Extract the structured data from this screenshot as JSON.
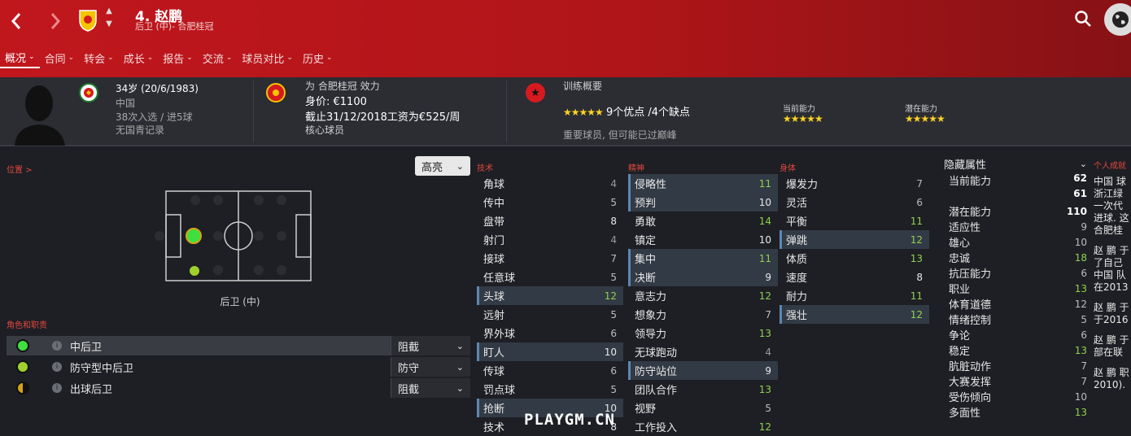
{
  "header": {
    "player_title": "4. 赵鹏",
    "player_subtitle": "后卫 (中)- 合肥桂冠",
    "tabs": [
      {
        "label": "概况"
      },
      {
        "label": "合同"
      },
      {
        "label": "转会"
      },
      {
        "label": "成长"
      },
      {
        "label": "报告"
      },
      {
        "label": "交流"
      },
      {
        "label": "球员对比"
      },
      {
        "label": "历史"
      }
    ],
    "accent_color": "#c0171d"
  },
  "info": {
    "age_line": "34岁 (20/6/1983)",
    "nation": "中国",
    "caps": "38次入选 / 进5球",
    "youth": "无国青记录",
    "club_line": "为 合肥桂冠 效力",
    "value_line": "身价: €1100",
    "contract_line": "截止31/12/2018工资为€525/周",
    "squad_status": "核心球员",
    "training_title": "训练概要",
    "strengths_weaknesses": "9个优点 /4个缺点",
    "training_note": "重要球员, 但可能已过巅峰",
    "current_ability_label": "当前能力",
    "potential_ability_label": "潜在能力",
    "rating_stars": 5
  },
  "position": {
    "title": "位置 >",
    "highlight_label": "高亮",
    "position_label": "后卫 (中)"
  },
  "roles": {
    "title": "角色和职责",
    "items": [
      {
        "name": "中后卫",
        "duty": "阻截",
        "color": "#3ee03e",
        "selected": true
      },
      {
        "name": "防守型中后卫",
        "duty": "防守",
        "color": "#9fd12e",
        "selected": false
      },
      {
        "name": "出球后卫",
        "duty": "阻截",
        "color": "#d4a21a",
        "selected": false
      }
    ]
  },
  "technical": {
    "title": "技术",
    "rows": [
      {
        "name": "角球",
        "value": "4",
        "hl": false
      },
      {
        "name": "传中",
        "value": "5",
        "hl": false
      },
      {
        "name": "盘带",
        "value": "8",
        "hl": false
      },
      {
        "name": "射门",
        "value": "4",
        "hl": false
      },
      {
        "name": "接球",
        "value": "7",
        "hl": false
      },
      {
        "name": "任意球",
        "value": "5",
        "hl": false
      },
      {
        "name": "头球",
        "value": "12",
        "hl": true
      },
      {
        "name": "远射",
        "value": "5",
        "hl": false
      },
      {
        "name": "界外球",
        "value": "6",
        "hl": false
      },
      {
        "name": "盯人",
        "value": "10",
        "hl": true
      },
      {
        "name": "传球",
        "value": "6",
        "hl": false
      },
      {
        "name": "罚点球",
        "value": "5",
        "hl": false
      },
      {
        "name": "抢断",
        "value": "10",
        "hl": true
      },
      {
        "name": "技术",
        "value": "8",
        "hl": false
      }
    ]
  },
  "mental": {
    "title": "精神",
    "rows": [
      {
        "name": "侵略性",
        "value": "11",
        "hl": true
      },
      {
        "name": "预判",
        "value": "10",
        "hl": true
      },
      {
        "name": "勇敢",
        "value": "14",
        "hl": false
      },
      {
        "name": "镇定",
        "value": "10",
        "hl": false
      },
      {
        "name": "集中",
        "value": "11",
        "hl": true
      },
      {
        "name": "决断",
        "value": "9",
        "hl": true
      },
      {
        "name": "意志力",
        "value": "12",
        "hl": false
      },
      {
        "name": "想象力",
        "value": "7",
        "hl": false
      },
      {
        "name": "领导力",
        "value": "13",
        "hl": false
      },
      {
        "name": "无球跑动",
        "value": "4",
        "hl": false
      },
      {
        "name": "防守站位",
        "value": "9",
        "hl": true
      },
      {
        "name": "团队合作",
        "value": "13",
        "hl": false
      },
      {
        "name": "视野",
        "value": "5",
        "hl": false
      },
      {
        "name": "工作投入",
        "value": "12",
        "hl": false
      }
    ]
  },
  "physical": {
    "title": "身体",
    "rows": [
      {
        "name": "爆发力",
        "value": "7",
        "hl": false
      },
      {
        "name": "灵活",
        "value": "6",
        "hl": false
      },
      {
        "name": "平衡",
        "value": "11",
        "hl": false
      },
      {
        "name": "弹跳",
        "value": "12",
        "hl": true
      },
      {
        "name": "体质",
        "value": "13",
        "hl": false
      },
      {
        "name": "速度",
        "value": "8",
        "hl": false
      },
      {
        "name": "耐力",
        "value": "11",
        "hl": false
      },
      {
        "name": "强壮",
        "value": "12",
        "hl": true
      }
    ]
  },
  "hidden": {
    "title": "隐藏属性",
    "current_ability": "62",
    "unlabeled_value": "61",
    "rows": [
      {
        "name": "当前能力",
        "value": ""
      },
      {
        "name": "",
        "value": ""
      },
      {
        "name": "潜在能力",
        "value": "110"
      },
      {
        "name": "适应性",
        "value": "9"
      },
      {
        "name": "雄心",
        "value": "10"
      },
      {
        "name": "忠诚",
        "value": "18"
      },
      {
        "name": "抗压能力",
        "value": "6"
      },
      {
        "name": "职业",
        "value": "13"
      },
      {
        "name": "体育道德",
        "value": "12"
      },
      {
        "name": "情绪控制",
        "value": "5"
      },
      {
        "name": "争论",
        "value": "6"
      },
      {
        "name": "稳定",
        "value": "13"
      },
      {
        "name": "肮脏动作",
        "value": "7"
      },
      {
        "name": "大赛发挥",
        "value": "7"
      },
      {
        "name": "受伤倾向",
        "value": "10"
      },
      {
        "name": "多面性",
        "value": "13"
      }
    ]
  },
  "bio": {
    "title": "个人成就",
    "lines": [
      "中国 球",
      "浙江绿",
      "一次代",
      "进球. 这",
      "合肥桂",
      "",
      "赵 鹏 于",
      "了自己",
      "中国 队",
      "在2013",
      "",
      "赵 鹏 于",
      "于2016",
      "",
      "赵 鹏 于",
      "部在联",
      "",
      "赵 鹏 职",
      "2010)."
    ]
  },
  "watermark": "PLAYGM.CN"
}
